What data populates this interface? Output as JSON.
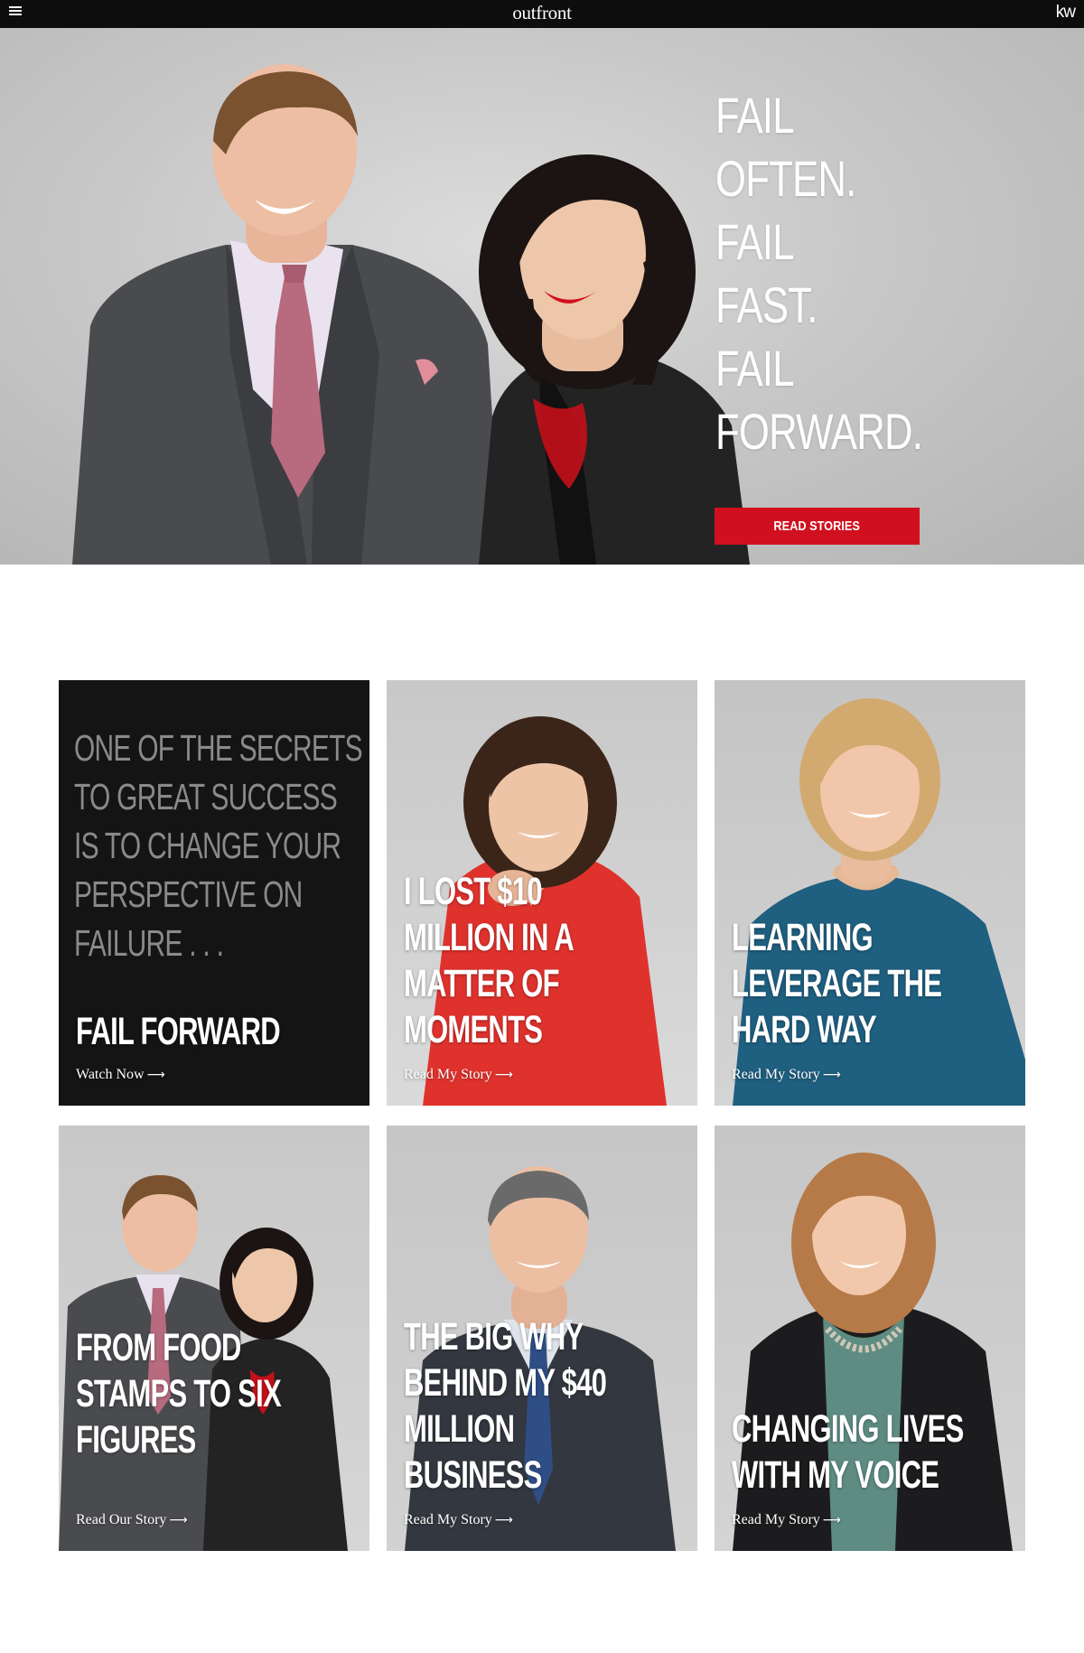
{
  "topbar": {
    "brand": "outfront",
    "partner_logo": "kw",
    "menu_icon": "hamburger-icon"
  },
  "hero": {
    "headline": [
      "FAIL",
      "OFTEN.",
      "FAIL",
      "FAST.",
      "FAIL",
      "FORWARD."
    ],
    "cta_label": "READ STORIES",
    "accent": "#d1101f"
  },
  "cards": [
    {
      "kind": "intro",
      "quote": [
        "ONE OF THE SECRETS",
        "TO GREAT SUCCESS",
        "IS TO CHANGE YOUR",
        "PERSPECTIVE ON",
        "FAILURE . . ."
      ],
      "title": [
        "FAIL FORWARD"
      ],
      "link": "Watch Now"
    },
    {
      "kind": "story",
      "title": [
        "I LOST $10",
        "MILLION IN A",
        "MATTER OF",
        "MOMENTS"
      ],
      "link": "Read My Story"
    },
    {
      "kind": "story",
      "title": [
        "LEARNING",
        "LEVERAGE THE",
        "HARD WAY"
      ],
      "link": "Read My Story"
    },
    {
      "kind": "story",
      "title": [
        "FROM FOOD",
        "STAMPS TO SIX",
        "FIGURES"
      ],
      "link": "Read Our Story"
    },
    {
      "kind": "story",
      "title": [
        "THE BIG WHY",
        "BEHIND MY $40",
        "MILLION",
        "BUSINESS"
      ],
      "link": "Read My Story"
    },
    {
      "kind": "story",
      "title": [
        "CHANGING LIVES",
        "WITH MY VOICE"
      ],
      "link": "Read My Story"
    }
  ]
}
